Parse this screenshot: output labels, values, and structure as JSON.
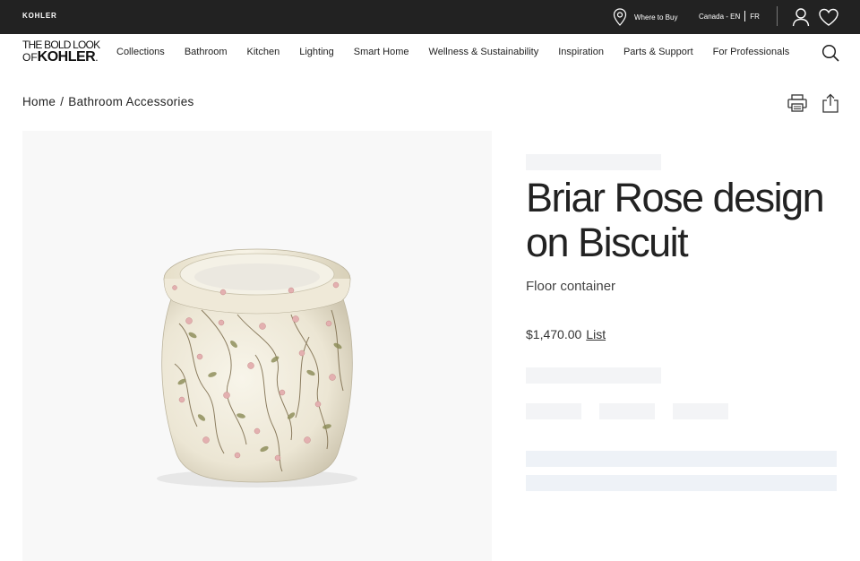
{
  "topbar": {
    "brand": "KOHLER",
    "where_to_buy": "Where to Buy",
    "locale_region": "Canada - EN",
    "locale_alt": "FR",
    "icons": [
      "location-pin-icon",
      "user-icon",
      "heart-icon"
    ]
  },
  "logo": {
    "line1": "THE BOLD LOOK",
    "line2_prefix": "OF",
    "line2_brand": "KOHLER",
    "line2_mark": "."
  },
  "nav": {
    "items": [
      {
        "label": "Collections"
      },
      {
        "label": "Bathroom"
      },
      {
        "label": "Kitchen"
      },
      {
        "label": "Lighting"
      },
      {
        "label": "Smart Home"
      },
      {
        "label": "Wellness & Sustainability"
      },
      {
        "label": "Inspiration"
      },
      {
        "label": "Parts & Support"
      },
      {
        "label": "For Professionals"
      }
    ],
    "search_icon": "search-icon"
  },
  "breadcrumb": {
    "home": "Home",
    "separator": "/",
    "current": "Bathroom Accessories"
  },
  "actions": {
    "print_icon": "printer-icon",
    "share_icon": "share-icon"
  },
  "product": {
    "title": "Briar Rose design on Biscuit",
    "subtitle": "Floor container",
    "price": "$1,470.00",
    "price_type": "List",
    "image_alt": "Briar Rose floor container"
  },
  "colors": {
    "topbar_bg": "#222222",
    "image_bg": "#f8f8f8",
    "skeleton": "#f3f4f6",
    "text": "#222222"
  }
}
